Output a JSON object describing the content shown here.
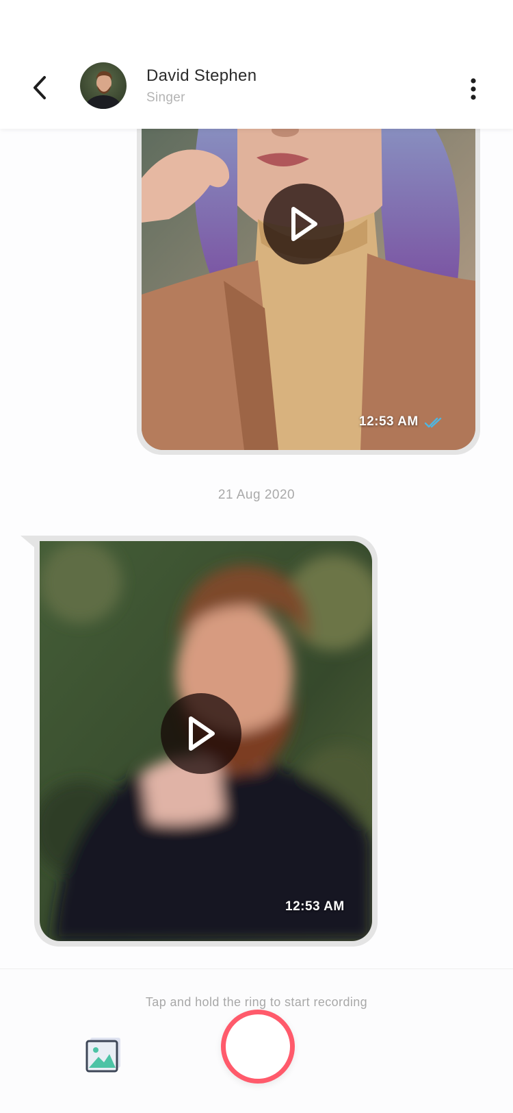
{
  "header": {
    "contact_name": "David Stephen",
    "contact_subtitle": "Singer",
    "back_icon": "chevron-left-icon",
    "menu_icon": "vertical-dots-icon"
  },
  "messages": [
    {
      "direction": "sent",
      "type": "video",
      "time": "12:53 AM",
      "status_icon": "double-check-icon",
      "status_color": "#4fb6e0"
    },
    {
      "direction": "received",
      "type": "video",
      "time": "12:53 AM"
    }
  ],
  "date_separator": "21 Aug 2020",
  "composer": {
    "hint": "Tap and hold the ring to start recording",
    "gallery_icon": "image-gallery-icon",
    "record_color": "#ff5a6b"
  }
}
